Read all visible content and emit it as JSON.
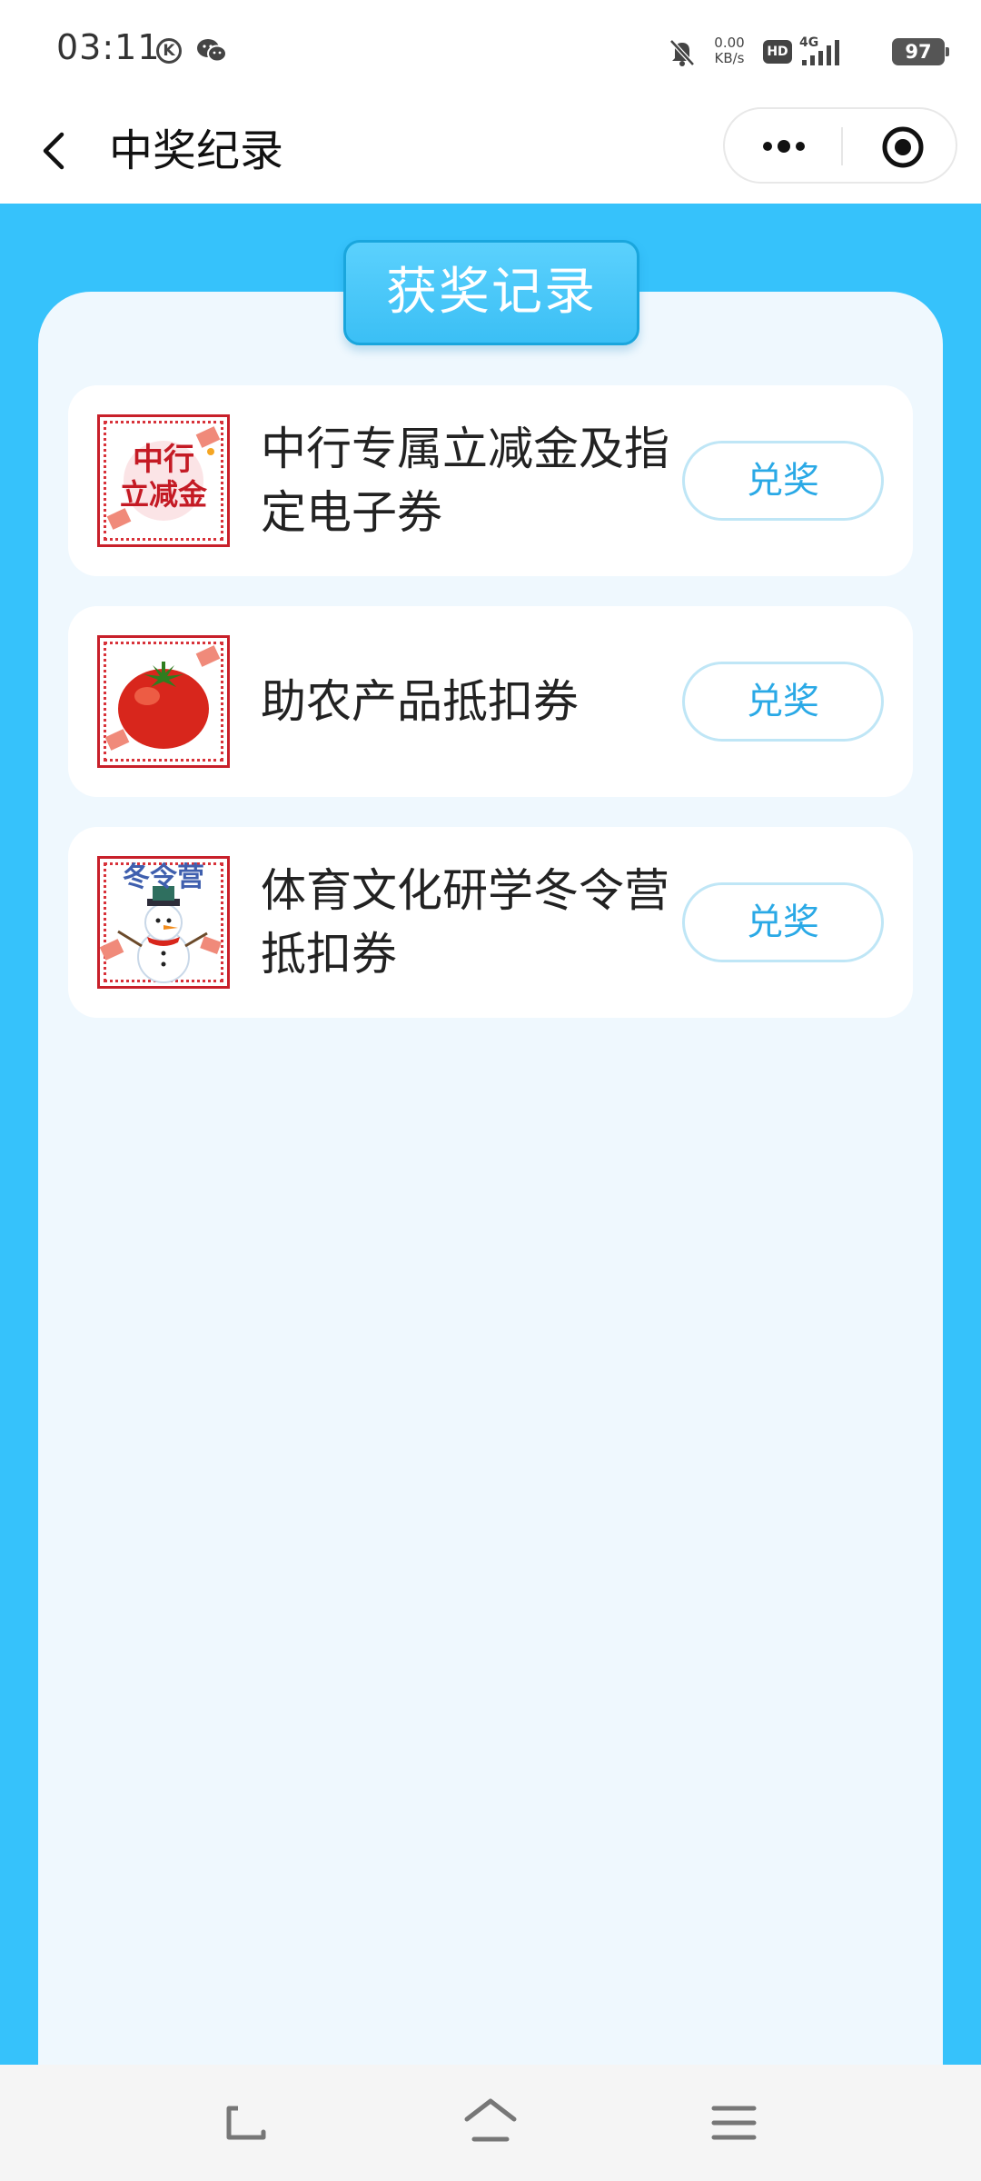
{
  "status_bar": {
    "time": "03:11",
    "k_icon_letter": "K",
    "net_speed_value": "0.00",
    "net_speed_unit": "KB/s",
    "hd_label": "HD",
    "network_type": "4G",
    "battery_level": "97"
  },
  "nav": {
    "title": "中奖纪录",
    "icons": [
      "back-arrow-icon",
      "more-dots-icon",
      "close-mini-program-icon"
    ]
  },
  "panel": {
    "title": "获奖记录"
  },
  "prizes": [
    {
      "name": "中行专属立减金及指定电子券",
      "thumb_text_line1": "中行",
      "thumb_text_line2": "立减金",
      "button_label": "兑奖",
      "icon": "bank-coupon-icon"
    },
    {
      "name": "助农产品抵扣券",
      "button_label": "兑奖",
      "icon": "tomato-icon"
    },
    {
      "name": "体育文化研学冬令营抵扣券",
      "thumb_text": "冬令营",
      "button_label": "兑奖",
      "icon": "snowman-icon"
    }
  ],
  "colors": {
    "background_blue": "#36c2fb",
    "panel_bg": "#eff8fe",
    "button_text": "#2aa9e6",
    "button_border": "#bfe6f6",
    "thumb_border": "#c8202a"
  },
  "system_nav": {
    "icons": [
      "sys-back-icon",
      "home-icon",
      "menu-icon"
    ]
  }
}
